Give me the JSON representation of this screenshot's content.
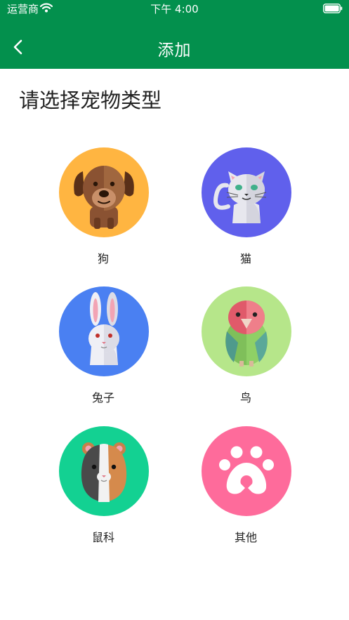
{
  "status_bar": {
    "carrier": "运营商",
    "time": "下午 4:00",
    "icons": [
      "wifi-icon",
      "battery-icon"
    ]
  },
  "nav": {
    "title": "添加",
    "back_icon": "chevron-left-icon"
  },
  "heading": "请选择宠物类型",
  "pets": [
    {
      "label": "狗",
      "icon": "dog-icon",
      "background": "#ffb541"
    },
    {
      "label": "猫",
      "icon": "cat-icon",
      "background": "#6060ec"
    },
    {
      "label": "兔子",
      "icon": "rabbit-icon",
      "background": "#4a80f2"
    },
    {
      "label": "鸟",
      "icon": "bird-icon",
      "background": "#b6e68a"
    },
    {
      "label": "鼠科",
      "icon": "guinea-pig-icon",
      "background": "#13d192"
    },
    {
      "label": "其他",
      "icon": "paw-icon",
      "background": "#fe6b9b"
    }
  ],
  "colors": {
    "nav_background": "#03904d",
    "nav_text": "#ffffff",
    "page_background": "#ffffff",
    "text": "#222222"
  }
}
